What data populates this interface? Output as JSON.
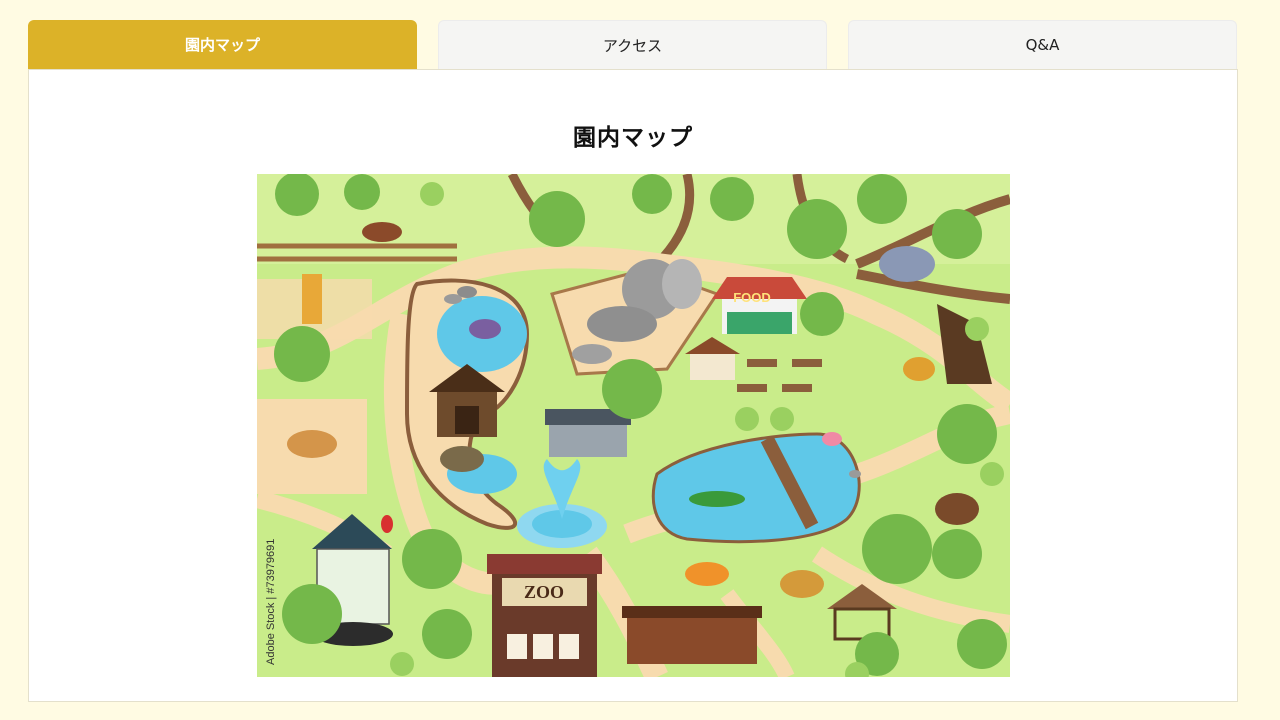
{
  "tabs": [
    {
      "label": "園内マップ",
      "active": true
    },
    {
      "label": "アクセス",
      "active": false
    },
    {
      "label": "Q&A",
      "active": false
    }
  ],
  "panel": {
    "title": "園内マップ",
    "map": {
      "food_sign": "FOOD",
      "zoo_sign": "ZOO",
      "watermark": "Adobe Stock | #73979691"
    }
  },
  "colors": {
    "background": "#fffbe3",
    "tab_active": "#dcb228",
    "tab_inactive": "#f5f5f3",
    "map_grass": "#c9ec8a",
    "map_path": "#f7dbae",
    "map_water": "#5fc8e8"
  }
}
